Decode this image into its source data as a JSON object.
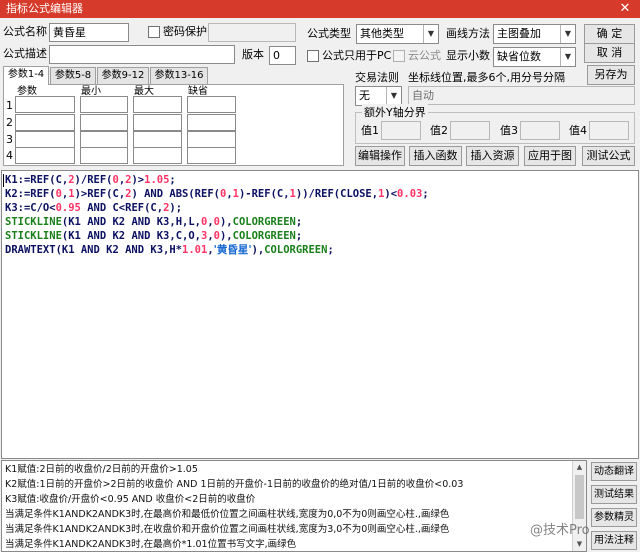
{
  "window": {
    "title": "指标公式编辑器",
    "close_glyph": "✕"
  },
  "form": {
    "name_label": "公式名称",
    "name_value": "黄昏星",
    "password_label": "密码保护",
    "type_label": "公式类型",
    "type_value": "其他类型",
    "draw_method_label": "画线方法",
    "draw_method_value": "主图叠加",
    "desc_label": "公式描述",
    "desc_value": "",
    "version_label": "版本",
    "version_value": "0",
    "pc_only_label": "公式只用于PC",
    "cloud_label": "云公式",
    "decimals_label": "显示小数",
    "decimals_value": "缺省位数"
  },
  "buttons": {
    "ok": "确 定",
    "cancel": "取 消",
    "save_as": "另存为",
    "edit_ops": "编辑操作",
    "insert_func": "插入函数",
    "insert_resource": "插入资源",
    "apply_chart": "应用于图",
    "test_formula": "测试公式"
  },
  "param_tabs": [
    "参数1-4",
    "参数5-8",
    "参数9-12",
    "参数13-16"
  ],
  "param_headers": [
    "参数",
    "最小",
    "最大",
    "缺省"
  ],
  "param_rows": [
    "1",
    "2",
    "3",
    "4"
  ],
  "trade_rule": {
    "label": "交易法则",
    "value": "无",
    "coord_label": "坐标线位置,最多6个,用分号分隔",
    "coord_value": "自动"
  },
  "y_axis": {
    "title": "额外Y轴分界",
    "labels": [
      "值1",
      "值2",
      "值3",
      "值4"
    ]
  },
  "code_lines": [
    [
      {
        "t": "K1:=REF(C,",
        "c": "kw"
      },
      {
        "t": "2",
        "c": "num"
      },
      {
        "t": ")/REF(",
        "c": "kw"
      },
      {
        "t": "0",
        "c": "num"
      },
      {
        "t": ",",
        "c": "kw"
      },
      {
        "t": "2",
        "c": "num"
      },
      {
        "t": ")>",
        "c": "kw"
      },
      {
        "t": "1.05",
        "c": "num"
      },
      {
        "t": ";",
        "c": "kw"
      }
    ],
    [
      {
        "t": "K2:=REF(",
        "c": "kw"
      },
      {
        "t": "0",
        "c": "num"
      },
      {
        "t": ",",
        "c": "kw"
      },
      {
        "t": "1",
        "c": "num"
      },
      {
        "t": ")>REF(C,",
        "c": "kw"
      },
      {
        "t": "2",
        "c": "num"
      },
      {
        "t": ") AND ABS(REF(",
        "c": "kw"
      },
      {
        "t": "0",
        "c": "num"
      },
      {
        "t": ",",
        "c": "kw"
      },
      {
        "t": "1",
        "c": "num"
      },
      {
        "t": ")-REF(C,",
        "c": "kw"
      },
      {
        "t": "1",
        "c": "num"
      },
      {
        "t": "))/REF(CLOSE,",
        "c": "kw"
      },
      {
        "t": "1",
        "c": "num"
      },
      {
        "t": ")<",
        "c": "kw"
      },
      {
        "t": "0.03",
        "c": "num"
      },
      {
        "t": ";",
        "c": "kw"
      }
    ],
    [
      {
        "t": "K3:=C/O<",
        "c": "kw"
      },
      {
        "t": "0.95",
        "c": "num"
      },
      {
        "t": " AND C<REF(C,",
        "c": "kw"
      },
      {
        "t": "2",
        "c": "num"
      },
      {
        "t": ");",
        "c": "kw"
      }
    ],
    [
      {
        "t": "STICKLINE",
        "c": "col"
      },
      {
        "t": "(K1 AND K2 AND K3,H,L,",
        "c": "kw"
      },
      {
        "t": "0",
        "c": "num"
      },
      {
        "t": ",",
        "c": "kw"
      },
      {
        "t": "0",
        "c": "num"
      },
      {
        "t": "),",
        "c": "kw"
      },
      {
        "t": "COLORGREEN",
        "c": "col"
      },
      {
        "t": ";",
        "c": "kw"
      }
    ],
    [
      {
        "t": "STICKLINE",
        "c": "col"
      },
      {
        "t": "(K1 AND K2 AND K3,C,O,",
        "c": "kw"
      },
      {
        "t": "3",
        "c": "num"
      },
      {
        "t": ",",
        "c": "kw"
      },
      {
        "t": "0",
        "c": "num"
      },
      {
        "t": "),",
        "c": "kw"
      },
      {
        "t": "COLORGREEN",
        "c": "col"
      },
      {
        "t": ";",
        "c": "kw"
      }
    ],
    [
      {
        "t": "DRAWTEXT(K1 AND K2 AND K3,H*",
        "c": "kw"
      },
      {
        "t": "1.01",
        "c": "num"
      },
      {
        "t": ",",
        "c": "kw"
      },
      {
        "t": "'黄昏星'",
        "c": "str"
      },
      {
        "t": "),",
        "c": "kw"
      },
      {
        "t": "COLORGREEN",
        "c": "col"
      },
      {
        "t": ";",
        "c": "kw"
      }
    ]
  ],
  "description_lines": [
    "K1赋值:2日前的收盘价/2日前的开盘价>1.05",
    "K2赋值:1日前的开盘价>2日前的收盘价 AND 1日前的开盘价-1日前的收盘价的绝对值/1日前的收盘价<0.03",
    "K3赋值:收盘价/开盘价<0.95 AND 收盘价<2日前的收盘价",
    "当满足条件K1ANDK2ANDK3时,在最高价和最低价位置之间画柱状线,宽度为0,0不为0则画空心柱.,画绿色",
    "当满足条件K1ANDK2ANDK3时,在收盘价和开盘价位置之间画柱状线,宽度为3,0不为0则画空心柱.,画绿色",
    "当满足条件K1ANDK2ANDK3时,在最高价*1.01位置书写文字,画绿色"
  ],
  "side_buttons": [
    "动态翻译",
    "测试结果",
    "参数精灵",
    "用法注释"
  ],
  "watermark": "@技术Pro",
  "colors": {
    "title_bar": "#d63a2a",
    "number": "#ff3366",
    "color_const": "#1a7f1a",
    "string": "#1a6ad1",
    "code": "#0b1060"
  }
}
